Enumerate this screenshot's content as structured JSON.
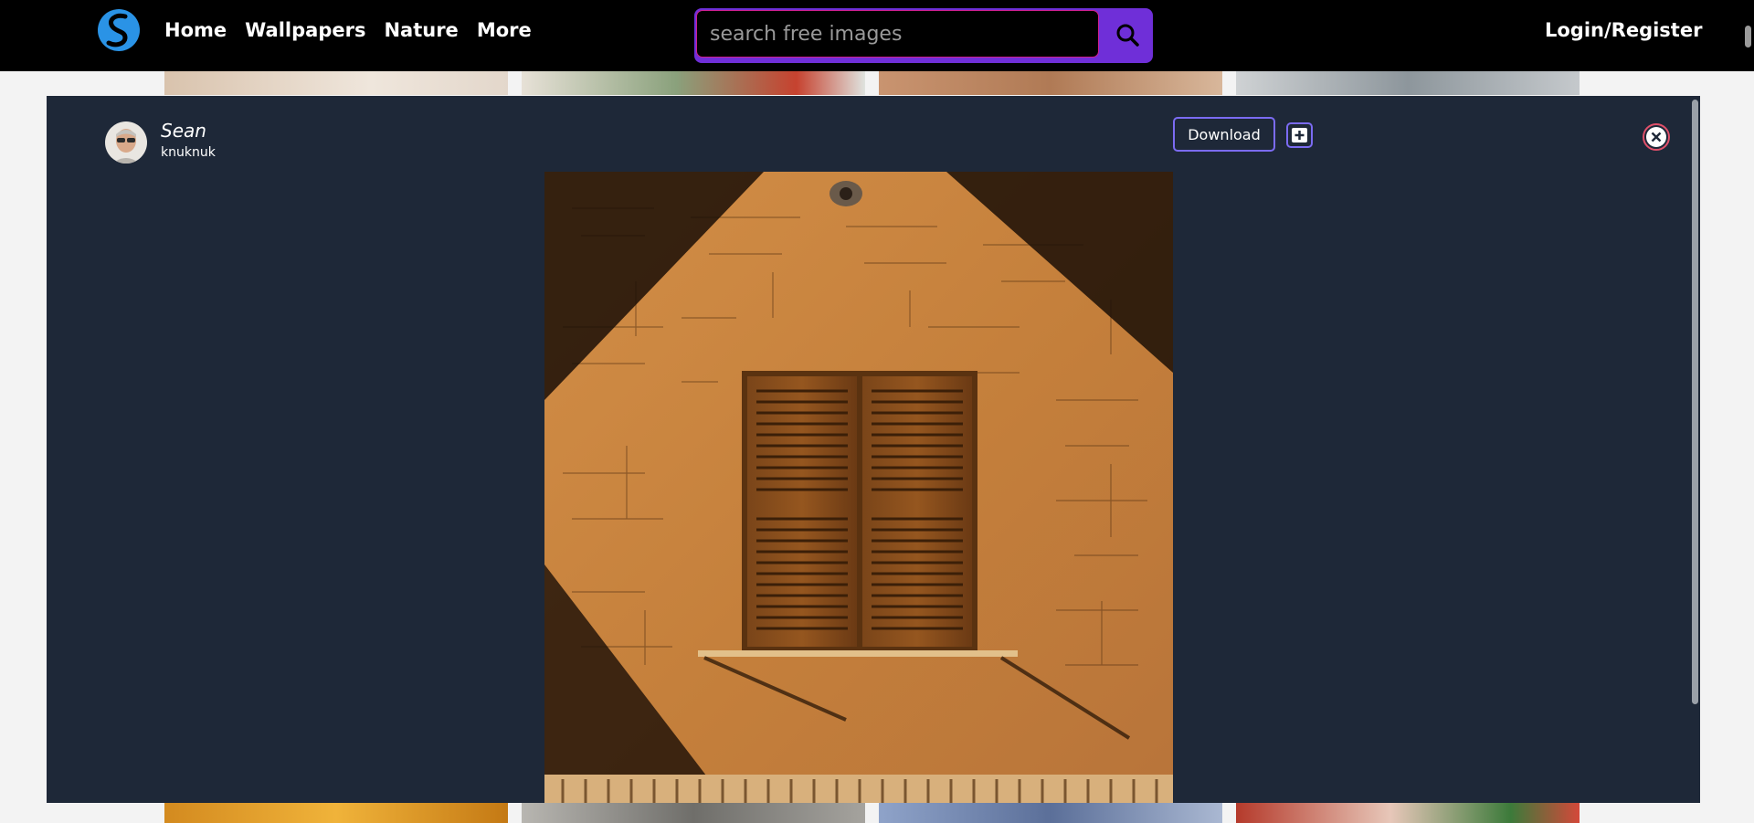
{
  "nav": {
    "links": [
      {
        "label": "Home"
      },
      {
        "label": "Wallpapers"
      },
      {
        "label": "Nature"
      },
      {
        "label": "More"
      }
    ],
    "search": {
      "placeholder": "search free images",
      "value": ""
    },
    "login_label": "Login/Register",
    "icons": {
      "logo": "site-logo-icon",
      "search": "search-icon"
    }
  },
  "modal": {
    "author": {
      "name": "Sean",
      "username": "knuknuk"
    },
    "download_label": "Download",
    "icons": {
      "add": "plus-icon",
      "close": "close-icon"
    },
    "photo": {
      "subject": "shuttered window on orange wall",
      "colors": {
        "wall": "#c8823f",
        "shadow": "#1a0e06",
        "shutter": "#6e3e16"
      }
    }
  },
  "colors": {
    "navbar_bg": "#000000",
    "modal_bg": "#1e2838",
    "accent_purple": "#6f2fd8",
    "button_border": "#7b6bf2",
    "search_border": "#cf1f8e",
    "close_border": "#e0506a"
  }
}
